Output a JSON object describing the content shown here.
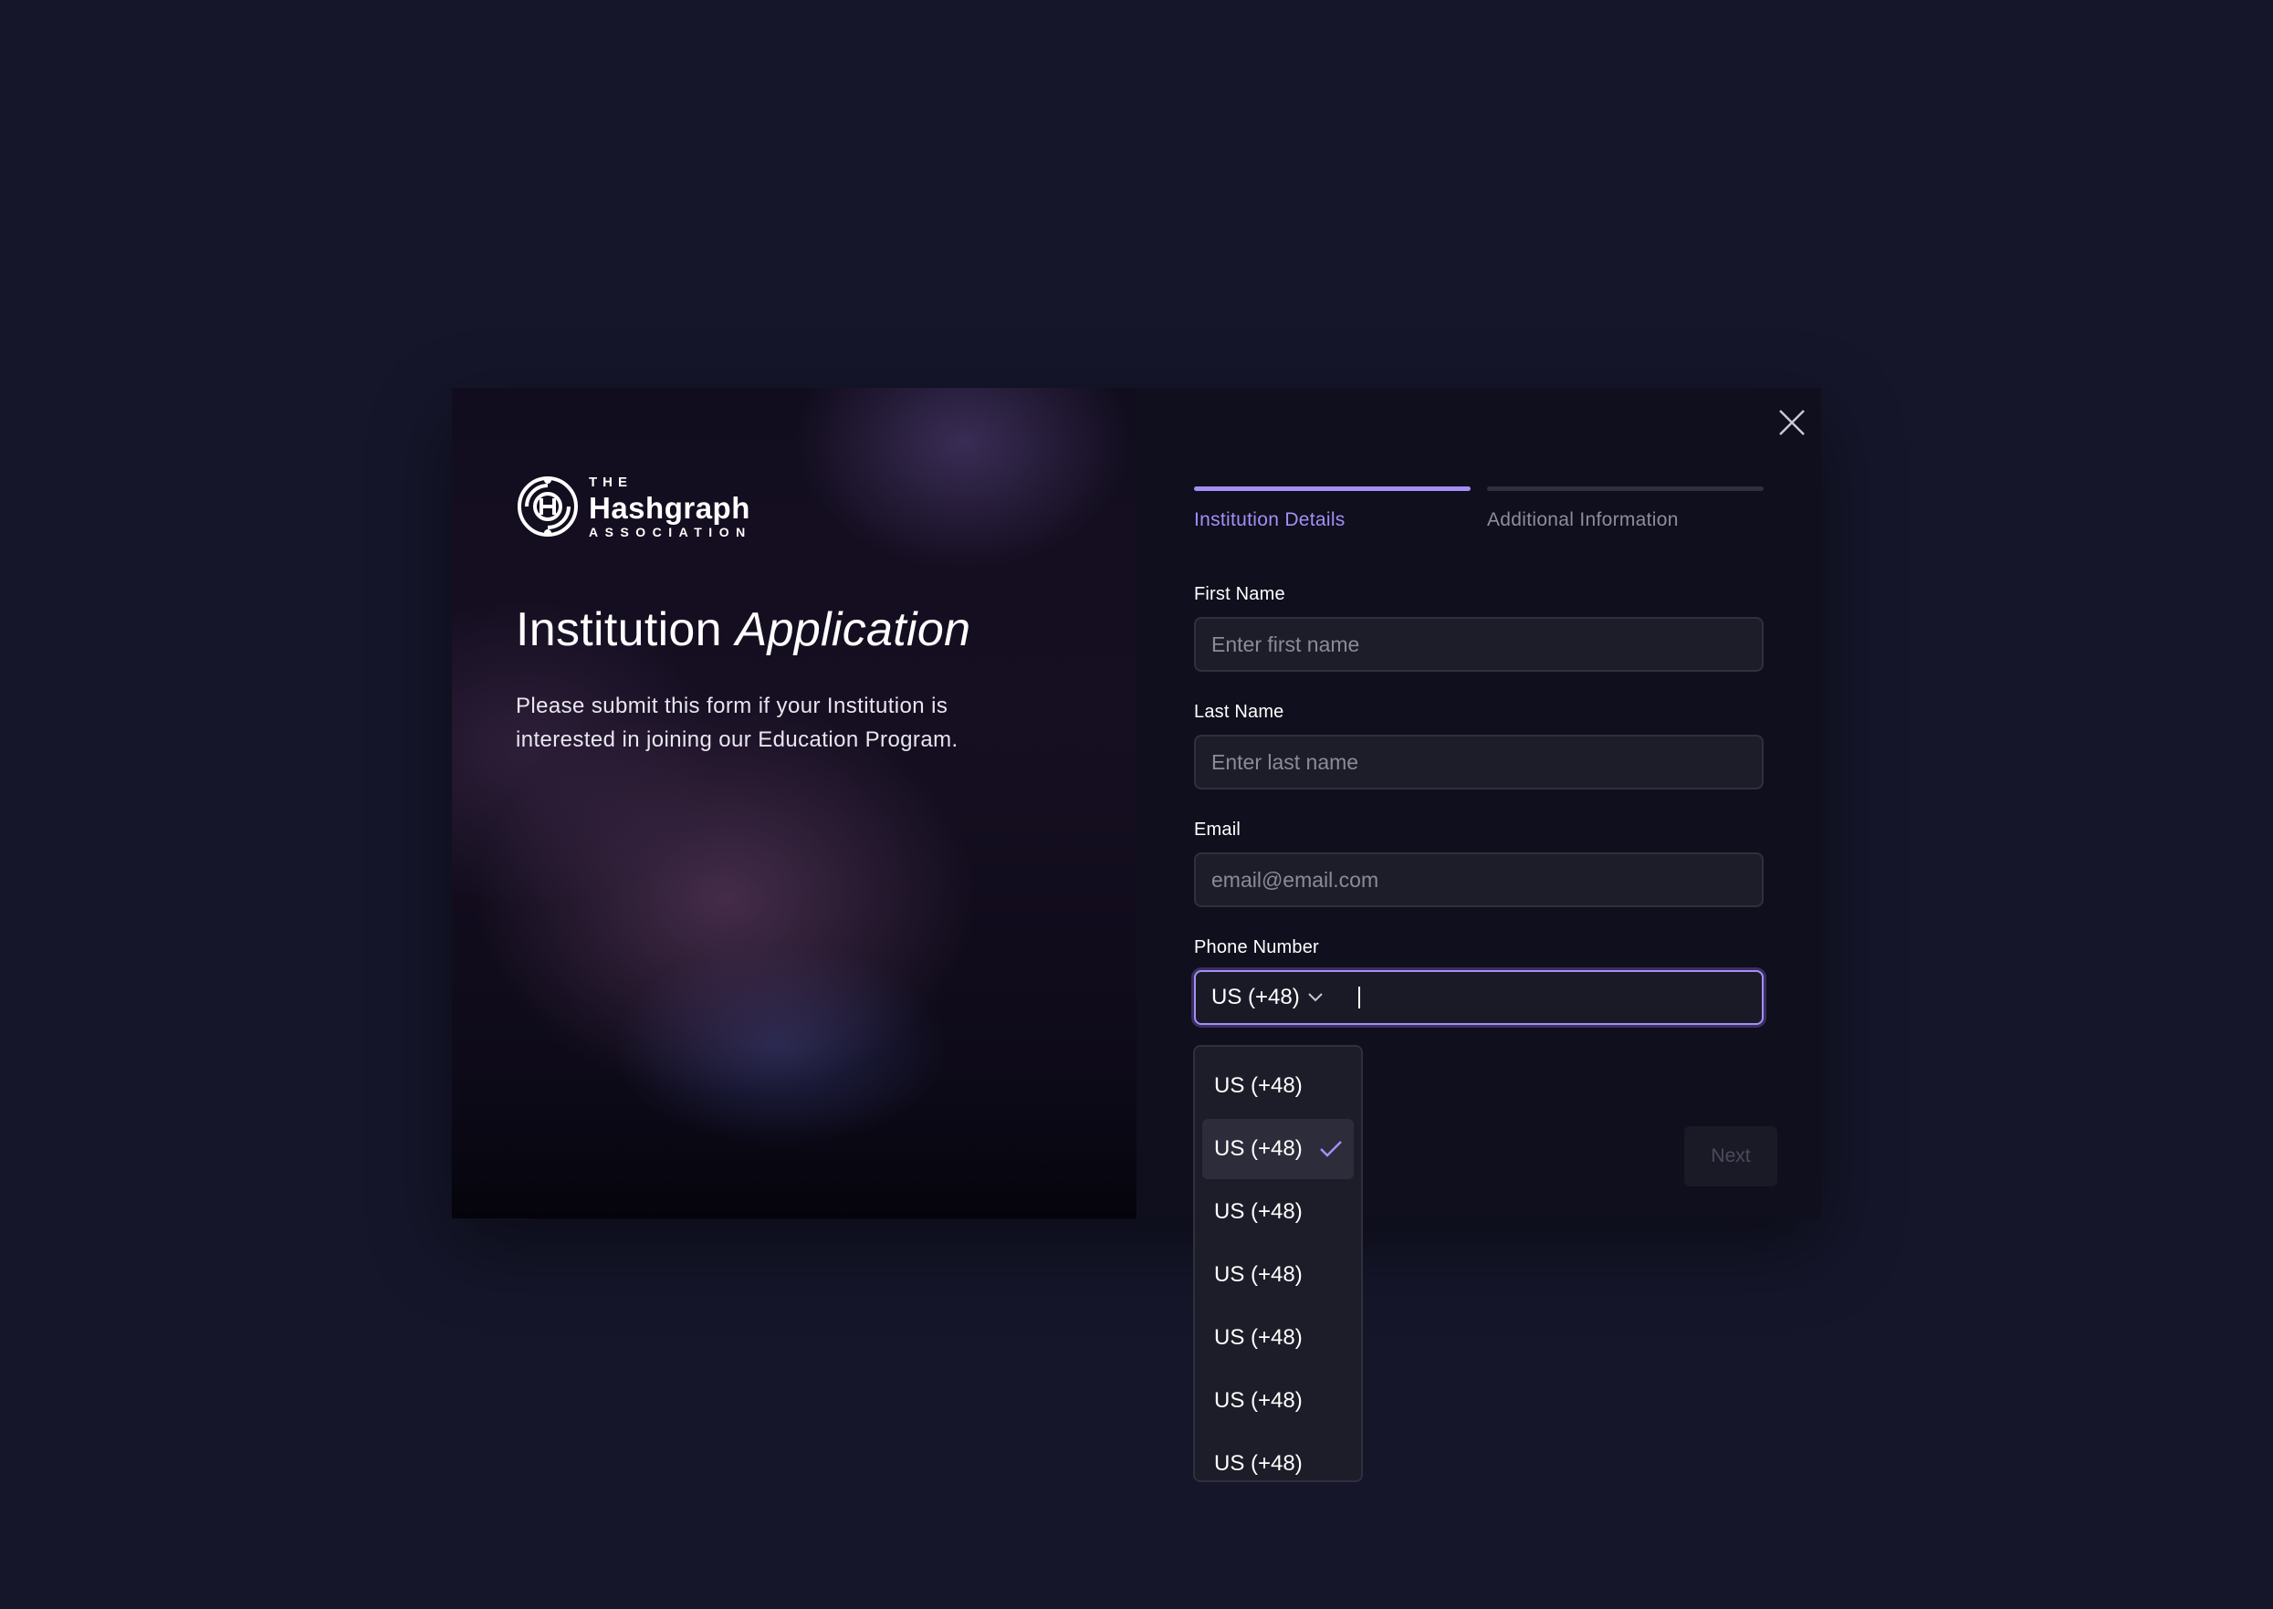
{
  "brand": {
    "logo_the": "THE",
    "logo_name": "Hashgraph",
    "logo_association": "ASSOCIATION"
  },
  "intro": {
    "title_plain": "Institution",
    "title_italic": "Application",
    "description": "Please submit this form if your Institution is interested in joining our Education Program."
  },
  "steps": [
    {
      "label": "Institution Details",
      "active": true
    },
    {
      "label": "Additional Information",
      "active": false
    }
  ],
  "form": {
    "first_name": {
      "label": "First Name",
      "placeholder": "Enter first name",
      "value": ""
    },
    "last_name": {
      "label": "Last Name",
      "placeholder": "Enter last name",
      "value": ""
    },
    "email": {
      "label": "Email",
      "placeholder": "email@email.com",
      "value": ""
    },
    "phone": {
      "label": "Phone Number",
      "country_code": "US (+48)",
      "value": ""
    }
  },
  "country_options": [
    {
      "label": "US (+48)",
      "selected": false
    },
    {
      "label": "US (+48)",
      "selected": true
    },
    {
      "label": "US (+48)",
      "selected": false
    },
    {
      "label": "US (+48)",
      "selected": false
    },
    {
      "label": "US (+48)",
      "selected": false
    },
    {
      "label": "US (+48)",
      "selected": false
    },
    {
      "label": "US (+48)",
      "selected": false
    }
  ],
  "actions": {
    "next_label": "Next",
    "next_enabled": false
  },
  "colors": {
    "accent": "#a68ef5",
    "page_background": "#15162a",
    "panel_background": "#0f0f1d",
    "input_background": "#1d1d2a"
  },
  "icons": {
    "close": "close-icon",
    "chevron": "chevron-down-icon",
    "check": "check-icon",
    "logo": "hashgraph-logo-icon"
  }
}
